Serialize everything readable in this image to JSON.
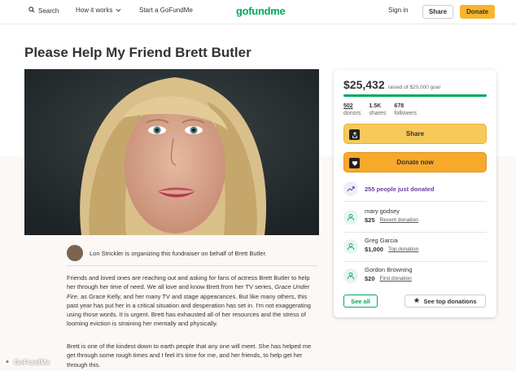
{
  "nav": {
    "search_label": "Search",
    "how_it_works_label": "How it works",
    "start_label": "Start a GoFundMe",
    "logo_text": "gofundme",
    "signin_label": "Sign in",
    "share_label": "Share",
    "donate_label": "Donate"
  },
  "campaign": {
    "title": "Please Help My Friend Brett Butler",
    "organizer_text": "Lon Strickler is organizing this fundraiser on behalf of Brett Butler.",
    "story": [
      {
        "pre": "Friends and loved ones are reaching out and asking for fans of actress Brett Butler to help her through her time of need. We all love and know Brett from her TV series, ",
        "italic": "Grace Under Fire",
        "post": ", as Grace Kelly, and her many TV and stage appearances. But like many others, this past year has put her in a critical situation and desperation has set in. I'm not exaggerating using those words. It is urgent. Brett has exhausted all of her resources and the stress of looming eviction is straining her mentally and physically."
      },
      {
        "text": "Brett is one of the kindest down to earth people that any one will meet. She has helped me get through some rough times and I feel it's time for me, and her friends, to help get her through this."
      }
    ]
  },
  "sidebar": {
    "raised_amount": "$25,432",
    "goal_text": "raised of $20,000 goal",
    "progress_fraction": 1.0,
    "stats": [
      {
        "value": "502",
        "label": "donors"
      },
      {
        "value": "1.5K",
        "label": "shares"
      },
      {
        "value": "678",
        "label": "followers"
      }
    ],
    "share_label": "Share",
    "donate_now_label": "Donate now",
    "trend_text": "255 people just donated",
    "donations": [
      {
        "name": "mary godsey",
        "amount": "$25",
        "tag": "Recent donation"
      },
      {
        "name": "Greg Garcia",
        "amount": "$1,000",
        "tag": "Top donation"
      },
      {
        "name": "Gordon Browning",
        "amount": "$20",
        "tag": "First donation"
      }
    ],
    "see_all_label": "See all",
    "see_top_label": "See top donations"
  },
  "watermark": "GoFundMe",
  "colors": {
    "brand_green": "#02a95c",
    "donate_orange": "#f7a92c",
    "share_yellow": "#f7c95a",
    "trend_purple": "#6b3fa0"
  }
}
